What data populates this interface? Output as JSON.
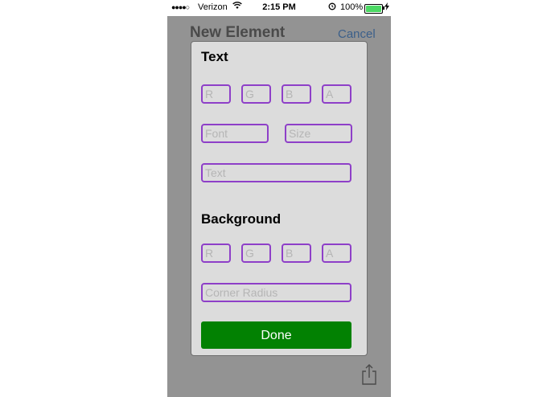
{
  "status_bar": {
    "signal": "●●●●○",
    "carrier": "Verizon",
    "time": "2:15 PM",
    "battery_percent": "100%"
  },
  "nav": {
    "title": "New Element",
    "cancel_label": "Cancel"
  },
  "text_section": {
    "title": "Text",
    "placeholders": {
      "r": "R",
      "g": "G",
      "b": "B",
      "a": "A",
      "font": "Font",
      "size": "Size",
      "text": "Text"
    }
  },
  "background_section": {
    "title": "Background",
    "placeholders": {
      "r": "R",
      "g": "G",
      "b": "B",
      "a": "A",
      "corner_radius": "Corner Radius"
    }
  },
  "done_label": "Done",
  "colors": {
    "field_border": "#8e3fc8",
    "done_button": "#028102",
    "overlay": "#939393",
    "modal": "#dcdcdc"
  },
  "icons": {
    "wifi": "wifi-icon",
    "alarm": "alarm-icon",
    "battery": "battery-icon",
    "share": "share-icon"
  }
}
